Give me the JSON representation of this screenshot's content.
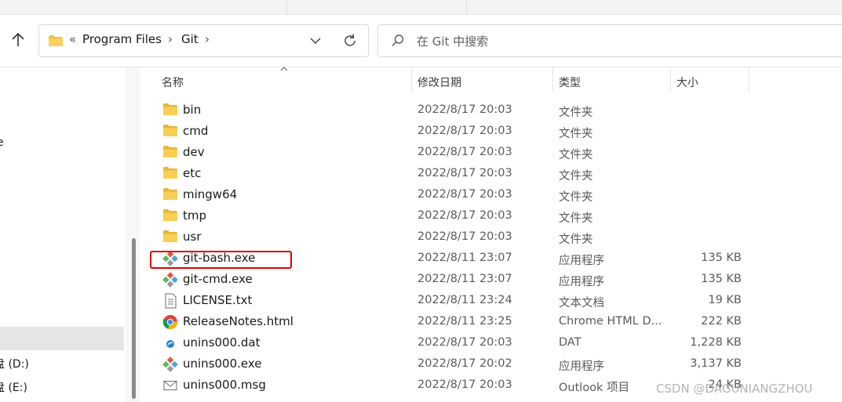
{
  "address": {
    "overflow": "«",
    "crumbs": [
      "Program Files",
      "Git"
    ]
  },
  "search": {
    "placeholder": "在 Git 中搜索"
  },
  "nav": {
    "stub_e": "e",
    "drives": [
      "盘 (D:)",
      "盘 (E:)"
    ]
  },
  "columns": {
    "name": "名称",
    "date": "修改日期",
    "type": "类型",
    "size": "大小"
  },
  "files": [
    {
      "name": "bin",
      "date": "2022/8/17 20:03",
      "type": "文件夹",
      "size": "",
      "icon": "folder-icon"
    },
    {
      "name": "cmd",
      "date": "2022/8/17 20:03",
      "type": "文件夹",
      "size": "",
      "icon": "folder-icon"
    },
    {
      "name": "dev",
      "date": "2022/8/17 20:03",
      "type": "文件夹",
      "size": "",
      "icon": "folder-icon"
    },
    {
      "name": "etc",
      "date": "2022/8/17 20:03",
      "type": "文件夹",
      "size": "",
      "icon": "folder-icon"
    },
    {
      "name": "mingw64",
      "date": "2022/8/17 20:03",
      "type": "文件夹",
      "size": "",
      "icon": "folder-icon"
    },
    {
      "name": "tmp",
      "date": "2022/8/17 20:03",
      "type": "文件夹",
      "size": "",
      "icon": "folder-icon"
    },
    {
      "name": "usr",
      "date": "2022/8/17 20:03",
      "type": "文件夹",
      "size": "",
      "icon": "folder-icon"
    },
    {
      "name": "git-bash.exe",
      "date": "2022/8/11 23:07",
      "type": "应用程序",
      "size": "135 KB",
      "icon": "git-icon"
    },
    {
      "name": "git-cmd.exe",
      "date": "2022/8/11 23:07",
      "type": "应用程序",
      "size": "135 KB",
      "icon": "git-icon"
    },
    {
      "name": "LICENSE.txt",
      "date": "2022/8/11 23:24",
      "type": "文本文档",
      "size": "19 KB",
      "icon": "text-file-icon"
    },
    {
      "name": "ReleaseNotes.html",
      "date": "2022/8/11 23:25",
      "type": "Chrome HTML D...",
      "size": "222 KB",
      "icon": "chrome-icon"
    },
    {
      "name": "unins000.dat",
      "date": "2022/8/17 20:03",
      "type": "DAT",
      "size": "1,228 KB",
      "icon": "dat-file-icon"
    },
    {
      "name": "unins000.exe",
      "date": "2022/8/17 20:02",
      "type": "应用程序",
      "size": "3,137 KB",
      "icon": "git-icon"
    },
    {
      "name": "unins000.msg",
      "date": "2022/8/17 20:03",
      "type": "Outlook 项目",
      "size": "24 KB",
      "icon": "mail-icon"
    }
  ],
  "watermark": "CSDN @DAGUNIANGZHOU",
  "colors": {
    "highlight": "#e00000",
    "folder": "#f2c14e",
    "selection": "#e5e5e5"
  }
}
